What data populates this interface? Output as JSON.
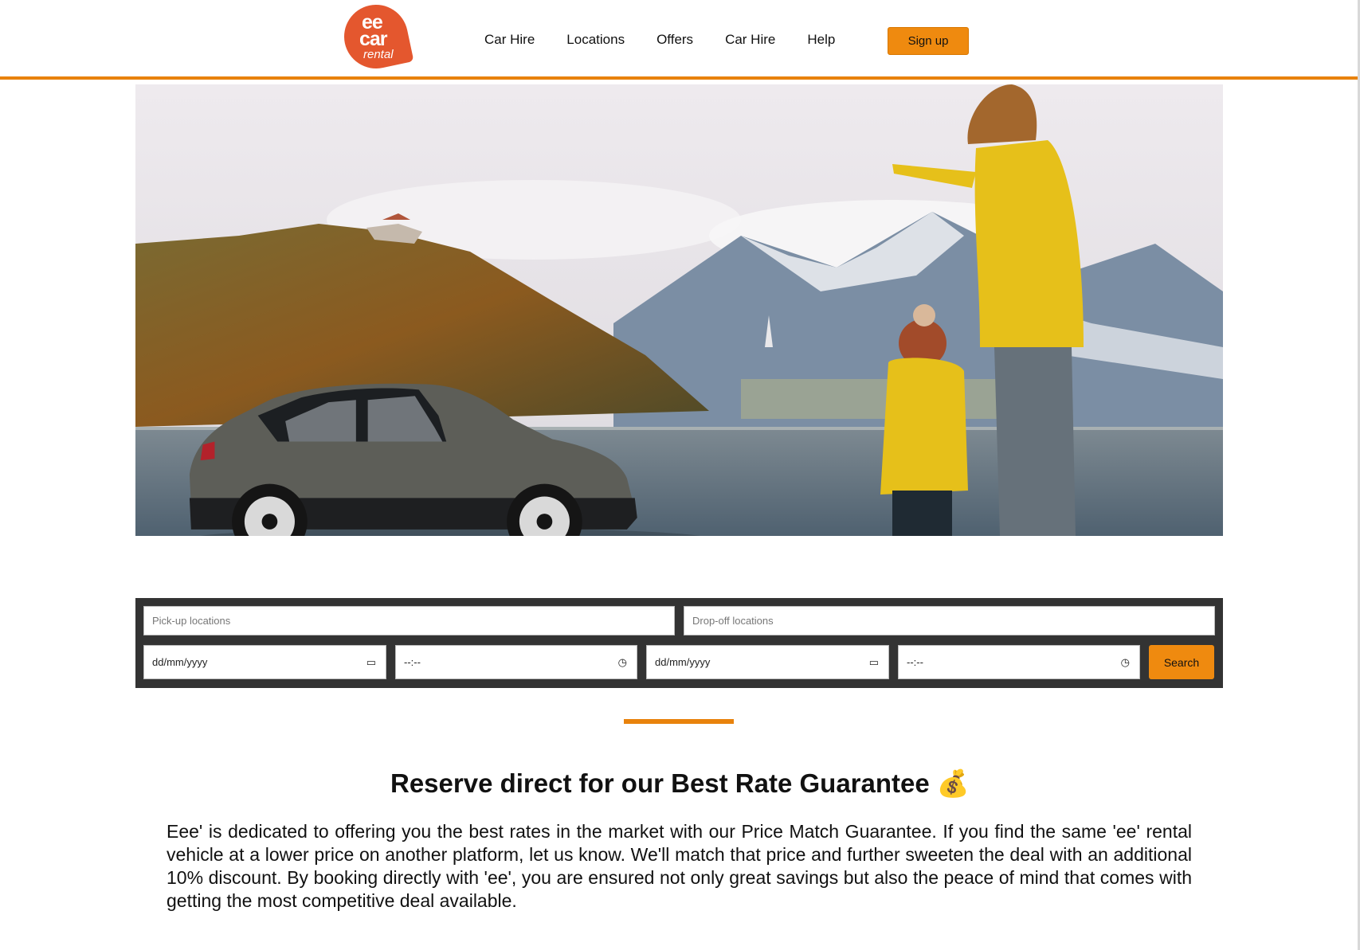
{
  "logo": {
    "line1": "ee",
    "line2": "car",
    "line3": "rental"
  },
  "nav": {
    "items": [
      {
        "label": "Car Hire"
      },
      {
        "label": "Locations"
      },
      {
        "label": "Offers"
      },
      {
        "label": "Car Hire"
      },
      {
        "label": "Help"
      }
    ],
    "signup_label": "Sign up"
  },
  "search": {
    "pickup_location": {
      "placeholder": "Pick-up locations",
      "value": ""
    },
    "dropoff_location": {
      "placeholder": "Drop-off locations",
      "value": ""
    },
    "pickup_date": {
      "display": "dd/mm/yyyy",
      "icon": "calendar-icon"
    },
    "pickup_time": {
      "display": "--:--",
      "icon": "clock-icon"
    },
    "dropoff_date": {
      "display": "dd/mm/yyyy",
      "icon": "calendar-icon"
    },
    "dropoff_time": {
      "display": "--:--",
      "icon": "clock-icon"
    },
    "button_label": "Search"
  },
  "content": {
    "title": "Reserve direct for our Best Rate Guarantee",
    "title_emoji": "💰",
    "paragraph": "Eee' is dedicated to offering you the best rates in the market with our Price Match Guarantee. If you find the same 'ee' rental vehicle at a lower price on another platform, let us know. We'll match that price and further sweeten the deal with an additional 10% discount. By booking directly with 'ee', you are ensured not only great savings but also the peace of mind that comes with getting the most competitive deal available."
  },
  "colors": {
    "accent": "#ef8a0f",
    "logo": "#e4572e",
    "panel": "#333333"
  }
}
